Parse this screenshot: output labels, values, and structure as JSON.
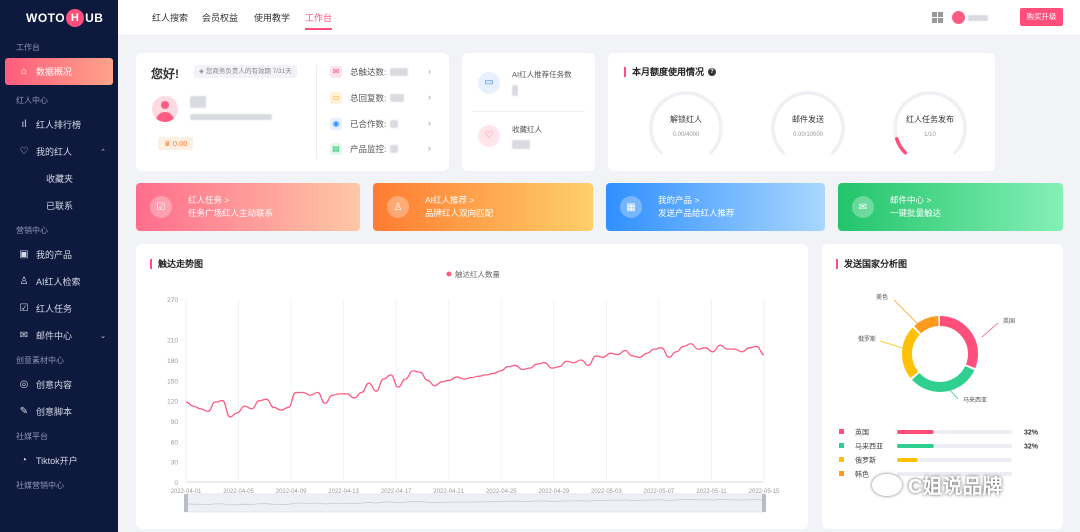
{
  "sidebar": {
    "logo": [
      "WOTO",
      "H",
      "UB"
    ],
    "section_workbench": "工作台",
    "item_home": "数据概况",
    "section_influencer": "红人中心",
    "item_ranking": "红人排行榜",
    "item_my_influencers": "我的红人",
    "sub_favorites": "收藏夹",
    "sub_contacted": "已联系",
    "section_marketing": "营销中心",
    "item_my_products": "我的产品",
    "item_ai_search": "AI红人检索",
    "item_tasks": "红人任务",
    "item_mail": "邮件中心",
    "section_creative": "创意素材中心",
    "item_creative_content": "创意内容",
    "item_creative_script": "创意脚本",
    "section_social": "社媒平台",
    "item_tiktok": "Tiktok开户",
    "section_social_marketing": "社媒营销中心"
  },
  "topbar": {
    "tabs": [
      "红人搜索",
      "会员权益",
      "使用教学",
      "工作台"
    ],
    "upgrade": "购买升级"
  },
  "profile": {
    "greeting": "您好!",
    "notice": "您商务负责人的有效期 7/31天",
    "badge": "0.00",
    "stats": [
      {
        "label": "总触达数:",
        "icon": "mail"
      },
      {
        "label": "总回复数:",
        "icon": "reply"
      },
      {
        "label": "已合作数:",
        "icon": "eye"
      },
      {
        "label": "产品监控:",
        "icon": "product"
      }
    ]
  },
  "ai": {
    "recommend": "AI红人推荐任务数",
    "favorites": "收藏红人"
  },
  "quota": {
    "title": "本月额度使用情况",
    "gauges": [
      {
        "label": "解锁红人",
        "value": "0.00/4000",
        "fraction": 0.0,
        "color": "#ff4f7a"
      },
      {
        "label": "邮件发送",
        "value": "0.00/10000",
        "fraction": 0.0,
        "color": "#ff4f7a"
      },
      {
        "label": "红人任务发布",
        "value": "1/10",
        "fraction": 0.1,
        "color": "#ff4f7a"
      }
    ]
  },
  "banners": [
    {
      "title": "红人任务 >",
      "desc": "任务广场红人主动联系",
      "icon": "task",
      "from": "#ff6d8c",
      "to": "#ffc8a6"
    },
    {
      "title": "AI红人推荐 >",
      "desc": "品牌红人双向匹配",
      "icon": "user",
      "from": "#ff7b32",
      "to": "#ffd06a"
    },
    {
      "title": "我的产品 >",
      "desc": "发送产品给红人推荐",
      "icon": "calendar",
      "from": "#2f8fff",
      "to": "#a9d7ff"
    },
    {
      "title": "邮件中心 >",
      "desc": "一键批量触达",
      "icon": "mail",
      "from": "#22c46b",
      "to": "#84f0b6"
    }
  ],
  "trend": {
    "title": "触达走势图",
    "legend": "触达红人数量"
  },
  "country": {
    "title": "发送国家分析图",
    "rows": [
      {
        "name": "英国",
        "pct": "32%",
        "fraction": 0.32,
        "color": "#ff4f7a"
      },
      {
        "name": "马来西亚",
        "pct": "32%",
        "fraction": 0.32,
        "color": "#2ecf8f"
      },
      {
        "name": "俄罗斯",
        "pct": "",
        "fraction": 0.18,
        "color": "#ffc107"
      },
      {
        "name": "韩色",
        "pct": "",
        "fraction": 0.0,
        "color": "#ff9a1f"
      }
    ],
    "donut_labels": [
      "英国",
      "马来西亚",
      "俄罗斯",
      "美色"
    ]
  },
  "watermark": "C姐说品牌",
  "chart_data": {
    "type": "line",
    "title": "",
    "legend": [
      "触达红人数量"
    ],
    "ylim": [
      0,
      270
    ],
    "yticks": [
      0,
      30,
      60,
      90,
      120,
      150,
      180,
      210,
      270
    ],
    "xticks": [
      "2022-04-01",
      "2022-04-05",
      "2022-04-09",
      "2022-04-13",
      "2022-04-17",
      "2022-04-21",
      "2022-04-25",
      "2022-04-29",
      "2022-05-03",
      "2022-05-07",
      "2022-05-11",
      "2022-05-15"
    ],
    "series": [
      {
        "name": "触达红人数量",
        "color": "#ff5c84",
        "values": [
          118,
          112,
          108,
          104,
          118,
          120,
          96,
          102,
          112,
          108,
          120,
          122,
          110,
          106,
          110,
          132,
          132,
          128,
          132,
          116,
          128,
          130,
          130,
          124,
          132,
          146,
          134,
          152,
          158,
          140,
          152,
          164,
          162,
          150,
          142,
          148,
          150,
          155,
          152,
          154,
          156,
          158,
          160,
          164,
          170,
          172,
          166,
          168,
          174,
          176,
          168,
          170,
          178,
          176,
          180,
          172,
          186,
          184,
          190,
          188,
          194,
          186,
          184,
          190,
          196,
          198,
          184,
          192,
          200,
          204,
          196,
          198,
          192,
          202,
          196,
          196,
          192,
          198,
          200,
          188
        ]
      }
    ]
  }
}
